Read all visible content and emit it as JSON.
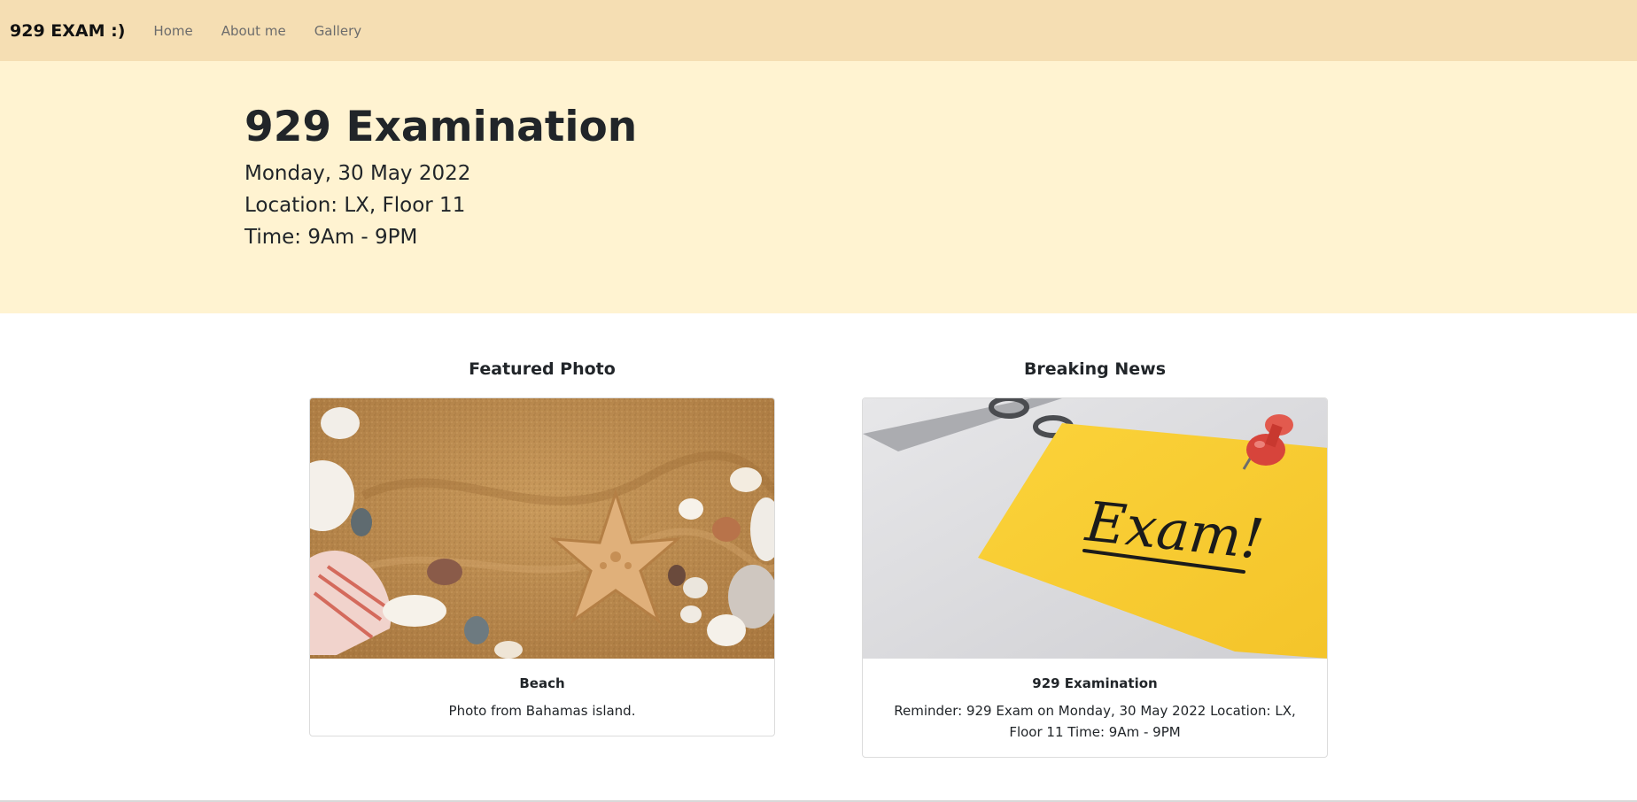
{
  "navbar": {
    "brand": "929 EXAM :)",
    "links": [
      "Home",
      "About me",
      "Gallery"
    ]
  },
  "hero": {
    "title": "929 Examination",
    "date": "Monday, 30 May 2022",
    "location": "Location: LX, Floor 11",
    "time": "Time: 9Am - 9PM"
  },
  "featured": {
    "heading": "Featured Photo",
    "card_title": "Beach",
    "card_text": "Photo from Bahamas island.",
    "image_text": ""
  },
  "news": {
    "heading": "Breaking News",
    "card_title": "929 Examination",
    "card_text": "Reminder: 929 Exam on Monday, 30 May 2022 Location: LX, Floor 11 Time: 9Am - 9PM",
    "image_text": "Exam!"
  },
  "colors": {
    "navbar_bg": "#f5deb3",
    "hero_bg": "#fff3d1",
    "note_yellow": "#f9d136",
    "pin_red": "#d7443b",
    "sand": "#c9995b"
  },
  "icons": [
    "beach-photo",
    "exam-note-photo",
    "pushpin-icon"
  ]
}
